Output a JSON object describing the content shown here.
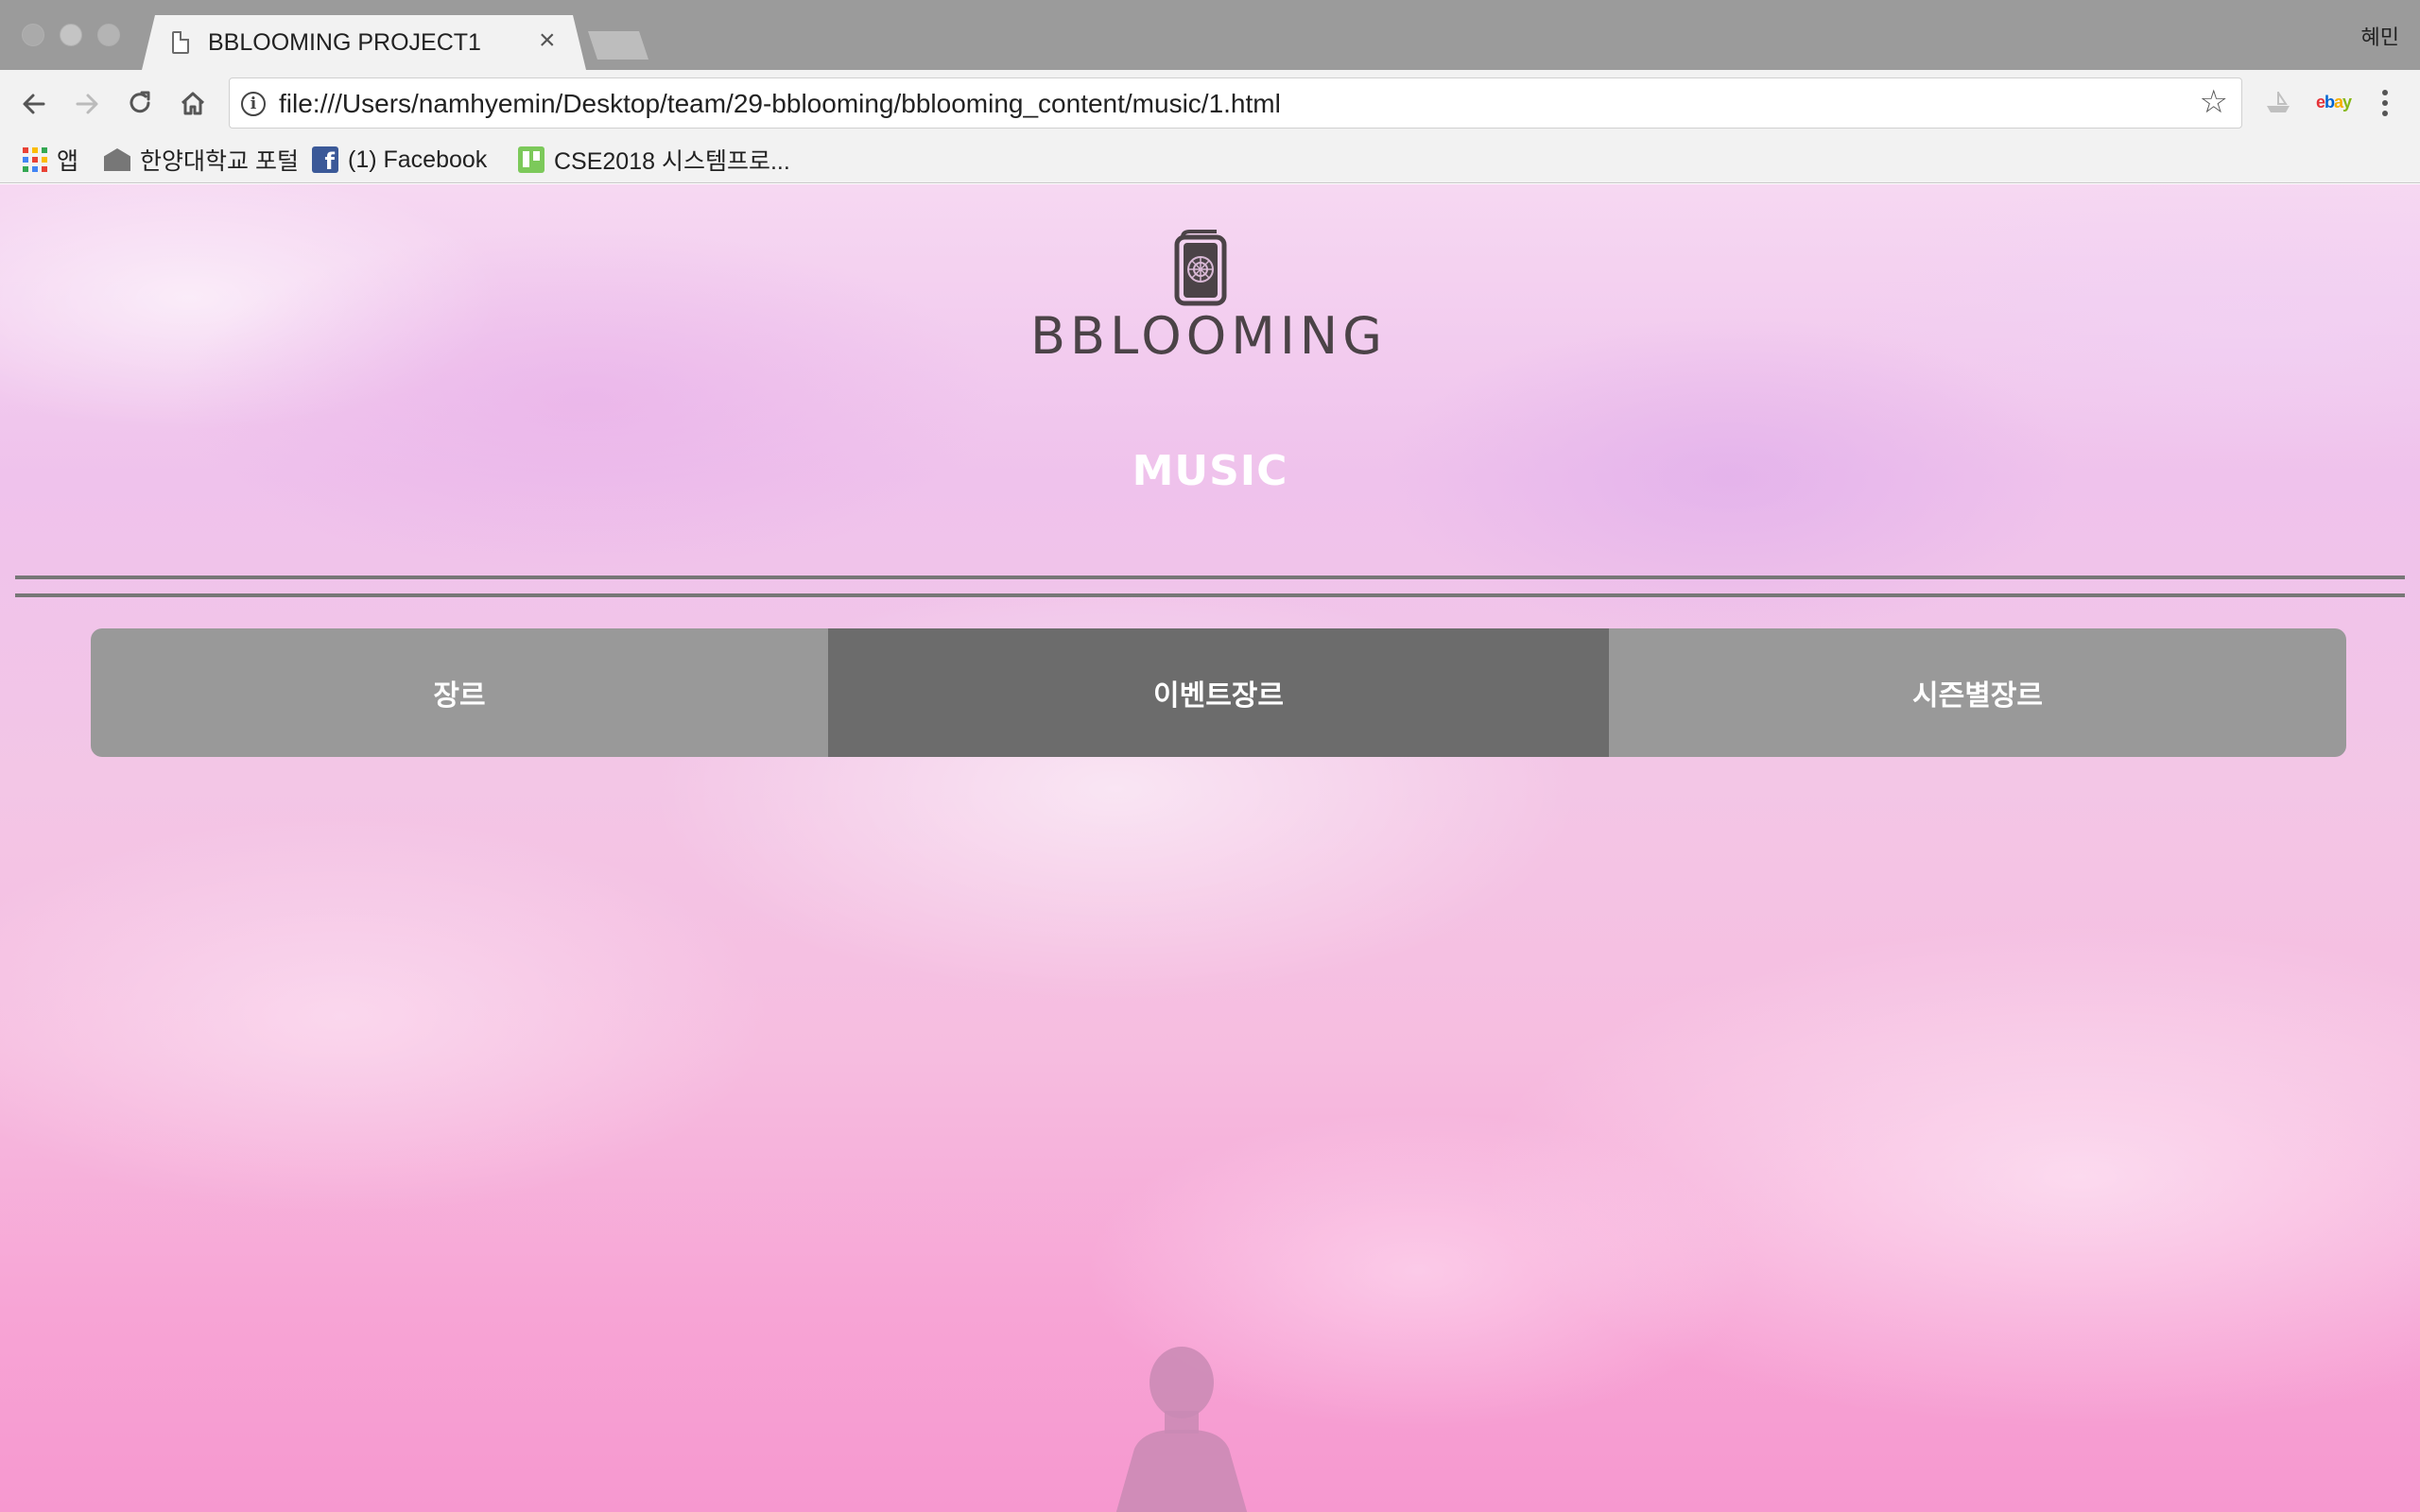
{
  "browser": {
    "tab_title": "BBLOOMING PROJECT1",
    "tab_close": "×",
    "profile_name": "혜민",
    "url": "file:///Users/namhyemin/Desktop/team/29-bblooming/bblooming_content/music/1.html",
    "info_icon": "i",
    "bookmark_star": "☆",
    "ebay": {
      "e": "e",
      "b": "b",
      "a": "a",
      "y": "y"
    }
  },
  "bookmarks": [
    {
      "label": "앱",
      "icon": "apps-grid-icon"
    },
    {
      "label": "한양대학교 포털",
      "icon": "university-icon"
    },
    {
      "label": "(1) Facebook",
      "icon": "facebook-icon"
    },
    {
      "label": "CSE2018 시스템프로...",
      "icon": "trello-icon"
    }
  ],
  "page": {
    "logo_text": "BBLOOMING",
    "section_title": "MUSIC",
    "tabs": [
      {
        "label": "장르",
        "active": false
      },
      {
        "label": "이벤트장르",
        "active": true
      },
      {
        "label": "시즌별장르",
        "active": false
      }
    ]
  },
  "colors": {
    "tab_inactive": "#999999",
    "tab_active": "#6c6c6c",
    "rule": "#777777",
    "logo": "#4b4347"
  }
}
